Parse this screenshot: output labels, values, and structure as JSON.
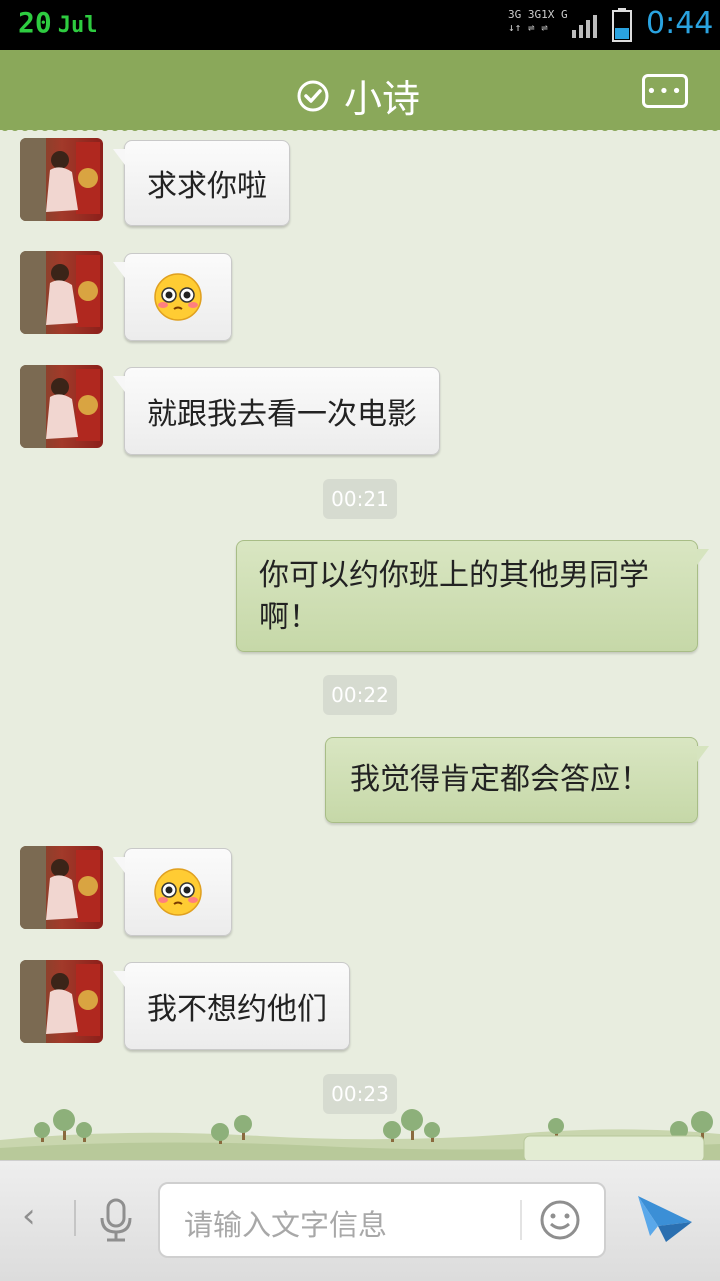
{
  "status_bar": {
    "day": "20",
    "month": "Jul",
    "network_labels": [
      "3G",
      "3G",
      "1X",
      "G"
    ],
    "time": "0:44"
  },
  "header": {
    "title": "小诗",
    "verified_icon": "check-circle-icon",
    "more_icon": "more-dots-icon"
  },
  "messages": [
    {
      "side": "left",
      "type": "text",
      "text": "求求你啦"
    },
    {
      "side": "left",
      "type": "emoji",
      "emoji": "pleading-face-emoji"
    },
    {
      "side": "left",
      "type": "text",
      "text": "就跟我去看一次电影"
    },
    {
      "side": "center",
      "type": "time",
      "text": "00:21"
    },
    {
      "side": "right",
      "type": "text",
      "text": "你可以约你班上的其他男同学啊！"
    },
    {
      "side": "center",
      "type": "time",
      "text": "00:22"
    },
    {
      "side": "right",
      "type": "text",
      "text": "我觉得肯定都会答应！"
    },
    {
      "side": "left",
      "type": "emoji",
      "emoji": "pleading-face-emoji"
    },
    {
      "side": "left",
      "type": "text",
      "text": "我不想约他们"
    },
    {
      "side": "center",
      "type": "time",
      "text": "00:23"
    }
  ],
  "input_bar": {
    "placeholder": "请输入文字信息",
    "back_icon": "chevron-left-icon",
    "mic_icon": "microphone-icon",
    "emoji_icon": "smiley-icon",
    "send_icon": "send-plane-icon"
  },
  "colors": {
    "header_bg": "#8aa85a",
    "chat_bg": "#e8eddf",
    "outgoing_bubble": "#cddcb3",
    "incoming_bubble": "#f4f4f4",
    "time_color": "#2aa3e0"
  }
}
